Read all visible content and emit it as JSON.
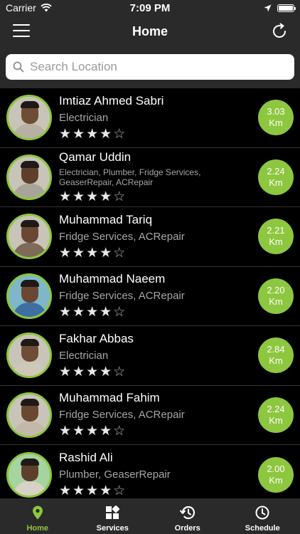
{
  "status_bar": {
    "carrier": "Carrier",
    "time": "7:09 PM"
  },
  "nav": {
    "title": "Home"
  },
  "search": {
    "placeholder": "Search Location"
  },
  "workers": [
    {
      "name": "Imtiaz Ahmed Sabri",
      "services": "Electrician",
      "rating": 4,
      "distance_value": "3.03",
      "distance_unit": "Km"
    },
    {
      "name": "Qamar Uddin",
      "services": "Electrician, Plumber, Fridge Services, GeaserRepair, ACRepair",
      "rating": 4,
      "distance_value": "2.24",
      "distance_unit": "Km"
    },
    {
      "name": "Muhammad Tariq",
      "services": "Fridge Services, ACRepair",
      "rating": 4,
      "distance_value": "2.21",
      "distance_unit": "Km"
    },
    {
      "name": "Muhammad Naeem",
      "services": "Fridge Services, ACRepair",
      "rating": 4,
      "distance_value": "2.20",
      "distance_unit": "Km"
    },
    {
      "name": "Fakhar Abbas",
      "services": "Electrician",
      "rating": 4,
      "distance_value": "2.84",
      "distance_unit": "Km"
    },
    {
      "name": "Muhammad Fahim",
      "services": "Fridge Services, ACRepair",
      "rating": 4,
      "distance_value": "2.24",
      "distance_unit": "Km"
    },
    {
      "name": "Rashid Ali",
      "services": "Plumber, GeaserRepair",
      "rating": 4,
      "distance_value": "2.00",
      "distance_unit": "Km"
    }
  ],
  "tabs": [
    {
      "label": "Home",
      "icon": "location-pin-icon",
      "active": true
    },
    {
      "label": "Services",
      "icon": "grid-icon",
      "active": false
    },
    {
      "label": "Orders",
      "icon": "history-icon",
      "active": false
    },
    {
      "label": "Schedule",
      "icon": "clock-icon",
      "active": false
    }
  ],
  "colors": {
    "accent": "#8dc63f",
    "bar": "#2a2a2a",
    "background": "#000000"
  }
}
